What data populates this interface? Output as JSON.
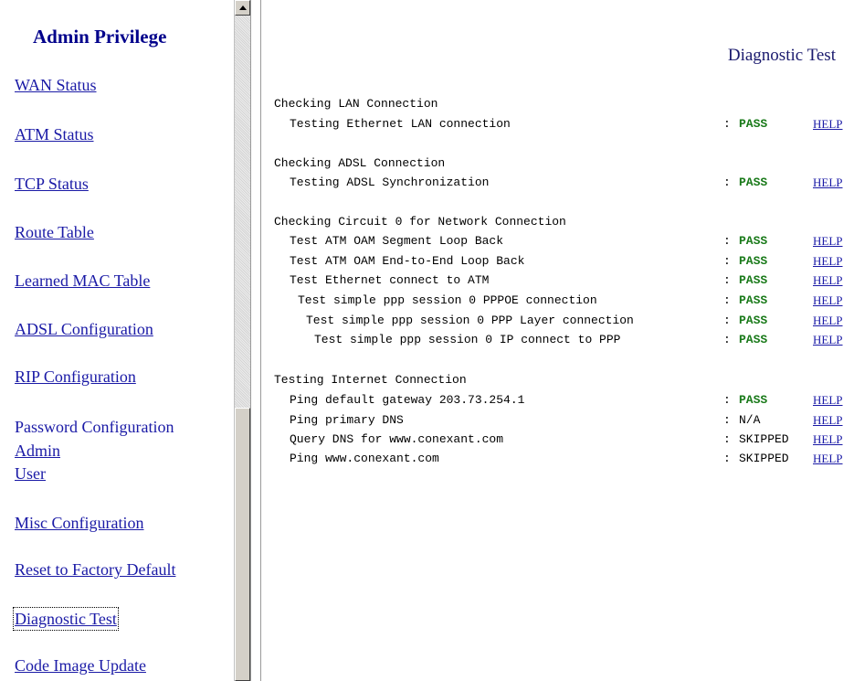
{
  "sidebar": {
    "title": "Admin Privilege",
    "items": [
      {
        "label": "WAN Status"
      },
      {
        "label": "ATM Status"
      },
      {
        "label": "TCP Status"
      },
      {
        "label": "Route Table"
      },
      {
        "label": "Learned MAC Table"
      },
      {
        "label": "ADSL Configuration"
      },
      {
        "label": "RIP Configuration"
      },
      {
        "label": "Password Configuration"
      },
      {
        "label": "Admin"
      },
      {
        "label": "User"
      },
      {
        "label": "Misc Configuration"
      },
      {
        "label": "Reset to Factory Default"
      },
      {
        "label": "Diagnostic Test"
      },
      {
        "label": "Code Image Update"
      }
    ]
  },
  "main": {
    "title": "Diagnostic Test",
    "sections": [
      {
        "heading": "Checking LAN Connection",
        "tests": [
          {
            "label": "Testing Ethernet LAN connection",
            "colon": ":",
            "result": "PASS",
            "help": "HELP"
          }
        ]
      },
      {
        "heading": "Checking ADSL Connection",
        "tests": [
          {
            "label": "Testing ADSL Synchronization",
            "colon": ":",
            "result": "PASS",
            "help": "HELP"
          }
        ]
      },
      {
        "heading": "Checking Circuit 0 for Network Connection",
        "tests": [
          {
            "label": "Test ATM OAM Segment Loop Back",
            "colon": ":",
            "result": "PASS",
            "help": "HELP"
          },
          {
            "label": "Test ATM OAM End-to-End Loop Back",
            "colon": ":",
            "result": "PASS",
            "help": "HELP"
          },
          {
            "label": "Test Ethernet connect to ATM",
            "colon": ":",
            "result": "PASS",
            "help": "HELP"
          },
          {
            "label": "Test simple ppp session 0 PPPOE connection",
            "colon": ":",
            "result": "PASS",
            "help": "HELP"
          },
          {
            "label": "Test simple ppp session 0 PPP Layer connection",
            "colon": ":",
            "result": "PASS",
            "help": "HELP"
          },
          {
            "label": "Test simple ppp session 0 IP connect to PPP",
            "colon": ":",
            "result": "PASS",
            "help": "HELP"
          }
        ]
      },
      {
        "heading": "Testing Internet Connection",
        "tests": [
          {
            "label": "Ping default gateway 203.73.254.1",
            "colon": ":",
            "result": "PASS",
            "help": "HELP"
          },
          {
            "label": "Ping primary DNS",
            "colon": ":",
            "result": "N/A",
            "help": "HELP"
          },
          {
            "label": "Query DNS for www.conexant.com",
            "colon": ":",
            "result": "SKIPPED",
            "help": "HELP"
          },
          {
            "label": "Ping www.conexant.com",
            "colon": ":",
            "result": "SKIPPED",
            "help": "HELP"
          }
        ]
      }
    ]
  },
  "colors": {
    "link": "#1a1aa6",
    "sidebar_title": "#00008b",
    "pass": "#1a7a1a"
  },
  "icons": {
    "scroll_up": "scroll-up-arrow-icon"
  }
}
